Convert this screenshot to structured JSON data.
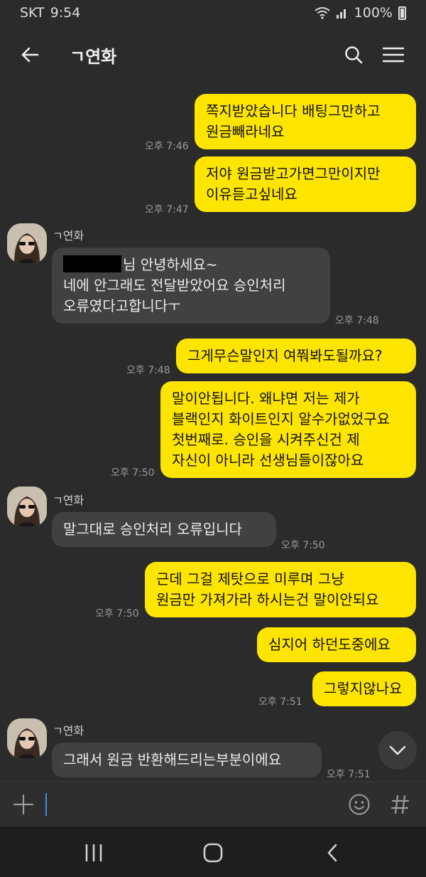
{
  "status": {
    "carrier": "SKT",
    "time": "9:54",
    "battery": "100%"
  },
  "header": {
    "title": "ㄱ연화"
  },
  "icons": {
    "back": "back-arrow-icon",
    "search": "search-icon",
    "menu": "menu-icon"
  },
  "messages": [
    {
      "from": "me",
      "text": "쪽지받았습니다 배팅그만하고\n원금빼라네요",
      "time": "오후 7:46"
    },
    {
      "from": "me",
      "text": "저야 원금받고가면그만이지만\n이유듣고싶네요",
      "time": "오후 7:47"
    },
    {
      "from": "them",
      "sender": "ㄱ연화",
      "text_after_redaction": "님 안녕하세요~",
      "text": "네에 안그래도 전달받았어요 승인처리\n오류였다고합니다ㅜ",
      "time": "오후 7:48"
    },
    {
      "from": "me",
      "text": "그게무슨말인지 여쭤봐도될까요?",
      "time": "오후 7:48"
    },
    {
      "from": "me",
      "text": "말이안됩니다. 왜냐면 저는 제가\n블랙인지 화이트인지 알수가없었구요\n첫번째로. 승인을 시켜주신건 제\n자신이 아니라 선생님들이잖아요",
      "time": "오후 7:50"
    },
    {
      "from": "them",
      "sender": "ㄱ연화",
      "text": "말그대로 승인처리 오류입니다",
      "time": "오후 7:50"
    },
    {
      "from": "me",
      "text": "근데 그걸 제탓으로 미루며 그냥\n원금만 가져가라 하시는건 말이안되요",
      "time": "오후 7:50"
    },
    {
      "from": "me",
      "text": "심지어 하던도중에요",
      "time": ""
    },
    {
      "from": "me",
      "text": "그렇지않나요",
      "time": "오후 7:51"
    },
    {
      "from": "them",
      "sender": "ㄱ연화",
      "text": "그래서 원금 반환해드리는부분이에요",
      "time": "오후 7:51"
    }
  ],
  "input": {
    "placeholder": ""
  }
}
